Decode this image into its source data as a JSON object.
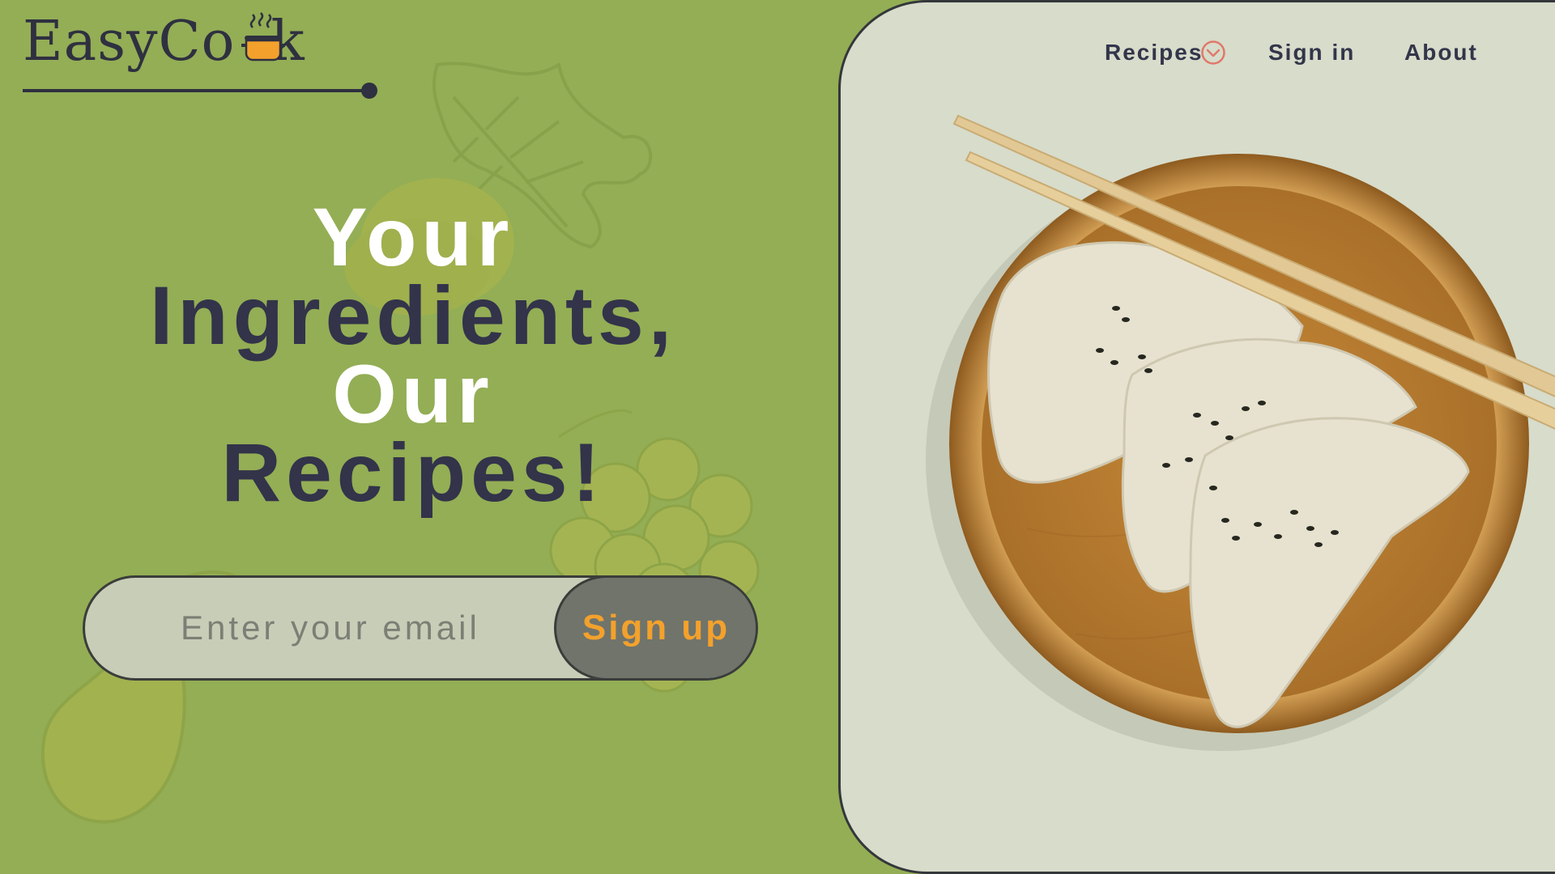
{
  "brand": {
    "name": "EasyCook",
    "name_prefix": "EasyCo",
    "name_suffix": "k"
  },
  "nav": {
    "recipes_label": "Recipes",
    "signin_label": "Sign in",
    "about_label": "About"
  },
  "hero": {
    "line1": "Your",
    "line2": "Ingredients,",
    "line3": "Our",
    "line4": "Recipes!"
  },
  "signup": {
    "email_placeholder": "Enter your email",
    "email_value": "",
    "button_label": "Sign up"
  },
  "colors": {
    "background_green": "#93ae55",
    "panel": "#d7dccb",
    "dark_text": "#33334a",
    "accent_orange": "#f3a12c",
    "nav_chevron": "#e0786a"
  },
  "icons": [
    "pot-logo-icon",
    "chevron-down-icon"
  ]
}
